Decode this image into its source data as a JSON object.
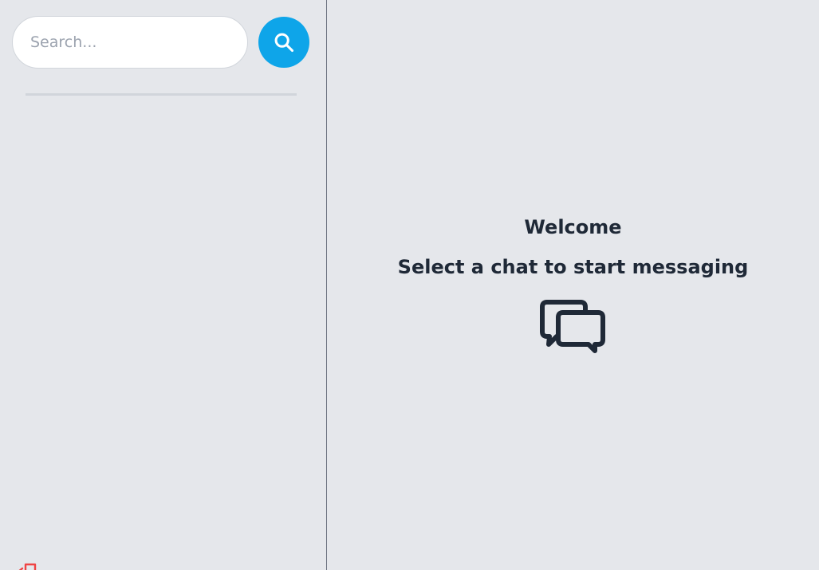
{
  "sidebar": {
    "search": {
      "placeholder": "Search...",
      "value": ""
    },
    "search_button_icon": "search-icon",
    "logout_icon": "logout-icon"
  },
  "main": {
    "welcome_title": "Welcome",
    "welcome_subtitle": "Select a chat to start messaging",
    "welcome_icon": "chat-bubbles-icon"
  },
  "colors": {
    "accent": "#0ea5e9",
    "background": "#e5e7eb",
    "text": "#1f2937",
    "logout": "#ef4444"
  }
}
